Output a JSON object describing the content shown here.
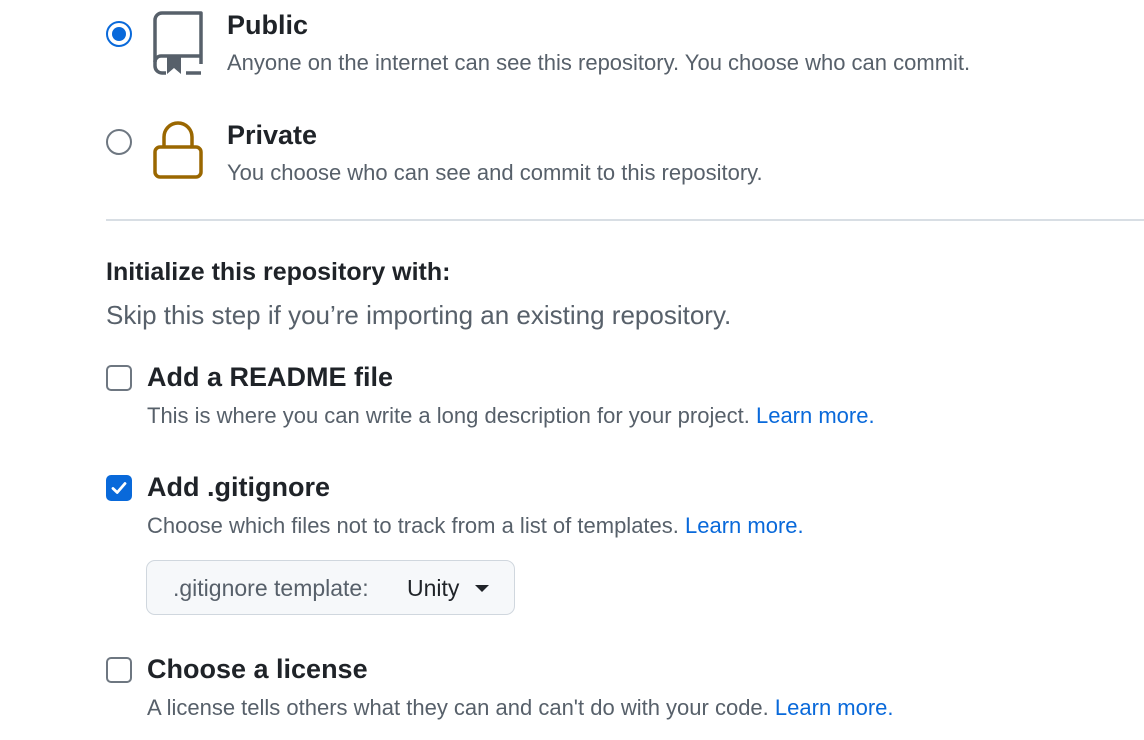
{
  "visibility": {
    "public": {
      "title": "Public",
      "description": "Anyone on the internet can see this repository. You choose who can commit.",
      "selected": true,
      "icon": "repo-icon"
    },
    "private": {
      "title": "Private",
      "description": "You choose who can see and commit to this repository.",
      "selected": false,
      "icon": "lock-icon"
    }
  },
  "initialize": {
    "heading": "Initialize this repository with:",
    "subheading": "Skip this step if you’re importing an existing repository.",
    "readme": {
      "label": "Add a README file",
      "description": "This is where you can write a long description for your project.",
      "learn_more": "Learn more.",
      "checked": false
    },
    "gitignore": {
      "label": "Add .gitignore",
      "description": "Choose which files not to track from a list of templates.",
      "learn_more": "Learn more.",
      "checked": true,
      "template_label": ".gitignore template:",
      "template_value": "Unity"
    },
    "license": {
      "label": "Choose a license",
      "description": "A license tells others what they can and can't do with your code.",
      "learn_more": "Learn more.",
      "checked": false
    }
  },
  "colors": {
    "accent": "#0969da",
    "text": "#1f2328",
    "muted": "#57606a",
    "lock": "#9a6700"
  }
}
